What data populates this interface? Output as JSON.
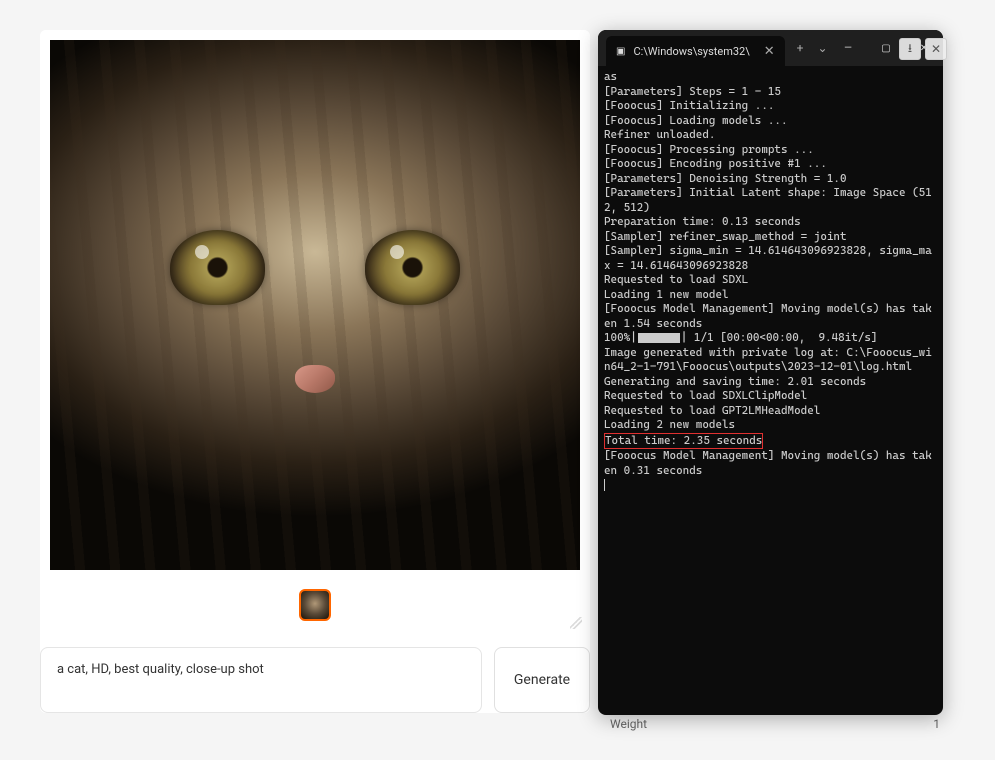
{
  "generator": {
    "prompt": "a cat, HD, best quality, close-up shot",
    "generate_label": "Generate",
    "download_icon": "⭳",
    "close_icon": "✕"
  },
  "underneath": {
    "weight_label": "Weight",
    "weight_value": "1"
  },
  "terminal": {
    "tab_title": "C:\\Windows\\system32\\",
    "tab_icon": "▣",
    "add_tab": "+",
    "dropdown": "⌄",
    "minimize": "—",
    "maximize": "▢",
    "close": "✕",
    "lines": [
      "as",
      "[Parameters] Steps = 1 - 15",
      "[Fooocus] Initializing ...",
      "[Fooocus] Loading models ...",
      "Refiner unloaded.",
      "[Fooocus] Processing prompts ...",
      "[Fooocus] Encoding positive #1 ...",
      "[Parameters] Denoising Strength = 1.0",
      "[Parameters] Initial Latent shape: Image Space (512, 512)",
      "Preparation time: 0.13 seconds",
      "[Sampler] refiner_swap_method = joint",
      "[Sampler] sigma_min = 14.614643096923828, sigma_max = 14.614643096923828",
      "Requested to load SDXL",
      "Loading 1 new model",
      "[Fooocus Model Management] Moving model(s) has taken 1.54 seconds"
    ],
    "progress_prefix": "100%|",
    "progress_suffix": "| 1/1 [00:00<00:00,  9.48it/s]",
    "lines2": [
      "Image generated with private log at: C:\\Fooocus_win64_2-1-791\\Fooocus\\outputs\\2023-12-01\\log.html",
      "Generating and saving time: 2.01 seconds",
      "Requested to load SDXLClipModel",
      "Requested to load GPT2LMHeadModel",
      "Loading 2 new models"
    ],
    "highlight": "Total time: 2.35 seconds",
    "lines3": [
      "[Fooocus Model Management] Moving model(s) has taken 0.31 seconds"
    ]
  }
}
